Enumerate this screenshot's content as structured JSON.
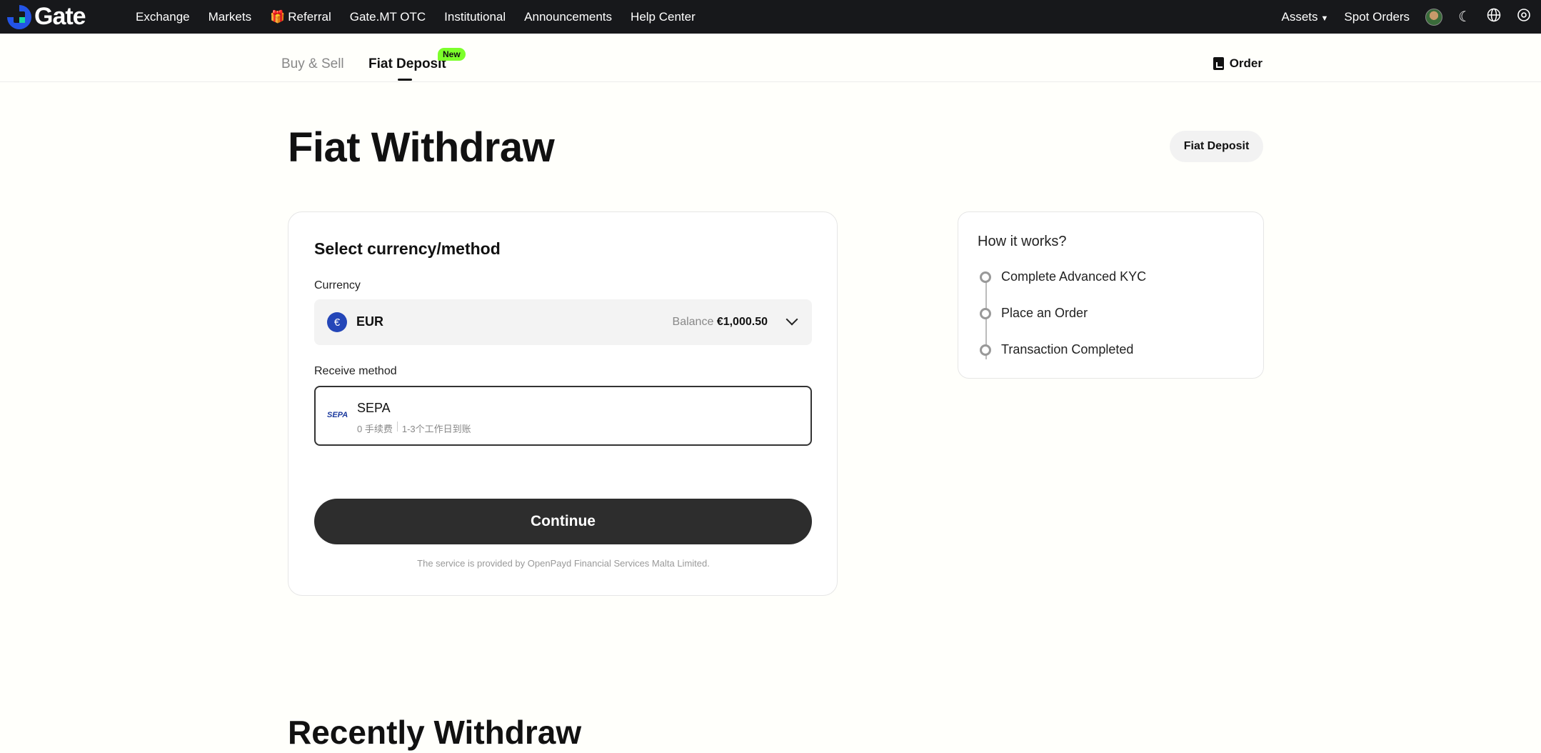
{
  "nav": {
    "logo": "Gate",
    "links": [
      "Exchange",
      "Markets",
      "Referral",
      "Gate.MT OTC",
      "Institutional",
      "Announcements",
      "Help Center"
    ],
    "assets": "Assets",
    "spot_orders": "Spot Orders"
  },
  "subtabs": {
    "buy_sell": "Buy & Sell",
    "fiat_deposit": "Fiat Deposit",
    "new_badge": "New",
    "order": "Order"
  },
  "page": {
    "title": "Fiat Withdraw",
    "fiat_deposit_button": "Fiat Deposit"
  },
  "form": {
    "title": "Select currency/method",
    "currency_label": "Currency",
    "currency_symbol": "€",
    "currency_code": "EUR",
    "balance_label": "Balance",
    "balance_value": "€1,000.50",
    "receive_label": "Receive method",
    "method_logo": "SEPA",
    "method_name": "SEPA",
    "method_fee": "0 手续费",
    "method_time": "1-3个工作日到账",
    "continue": "Continue",
    "service_note": "The service is provided by OpenPayd Financial Services Malta Limited."
  },
  "how": {
    "title": "How it works?",
    "steps": [
      "Complete Advanced KYC",
      "Place an Order",
      "Transaction Completed"
    ]
  },
  "recent": {
    "title": "Recently Withdraw"
  }
}
